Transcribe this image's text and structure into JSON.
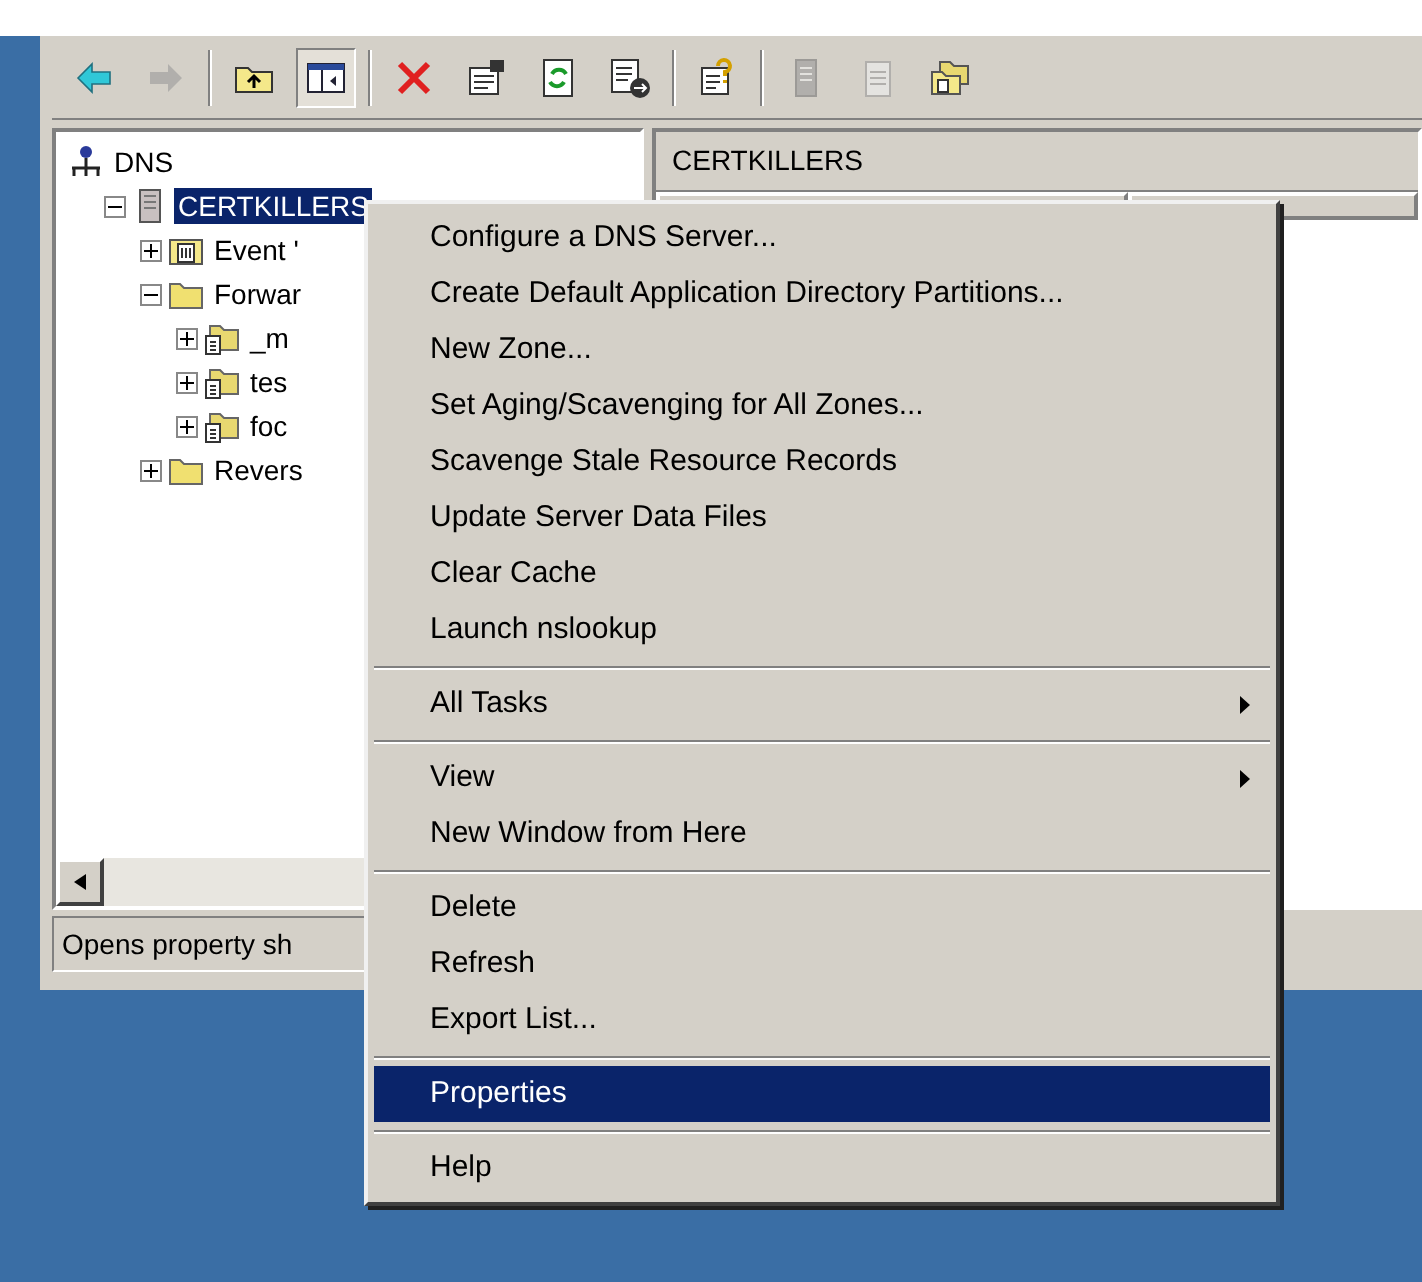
{
  "toolbar": [
    {
      "kind": "back",
      "disabled": false,
      "pressed": false
    },
    {
      "kind": "forward",
      "disabled": true,
      "pressed": false
    },
    {
      "kind": "sep"
    },
    {
      "kind": "up",
      "disabled": false,
      "pressed": false
    },
    {
      "kind": "tree",
      "disabled": false,
      "pressed": true
    },
    {
      "kind": "sep"
    },
    {
      "kind": "delete",
      "disabled": false,
      "pressed": false
    },
    {
      "kind": "properties",
      "disabled": false,
      "pressed": false
    },
    {
      "kind": "refresh",
      "disabled": false,
      "pressed": false
    },
    {
      "kind": "export",
      "disabled": false,
      "pressed": false
    },
    {
      "kind": "sep"
    },
    {
      "kind": "help",
      "disabled": false,
      "pressed": false
    },
    {
      "kind": "sep"
    },
    {
      "kind": "server",
      "disabled": true,
      "pressed": false
    },
    {
      "kind": "notepad",
      "disabled": true,
      "pressed": false
    },
    {
      "kind": "folders",
      "disabled": false,
      "pressed": false
    }
  ],
  "tree": [
    {
      "label": "DNS",
      "kind": "dns",
      "selected": false,
      "children": [
        {
          "label": "CERTKILLERS",
          "kind": "server",
          "selected": true,
          "expanded": true,
          "children": [
            {
              "label": "Event '",
              "kind": "log",
              "selected": false,
              "expanded": false
            },
            {
              "label": "Forwar",
              "kind": "folder",
              "selected": false,
              "expanded": true,
              "children": [
                {
                  "label": "_m",
                  "kind": "zone",
                  "selected": false,
                  "expanded": false
                },
                {
                  "label": "tes",
                  "kind": "zone",
                  "selected": false,
                  "expanded": false
                },
                {
                  "label": "foc",
                  "kind": "zone",
                  "selected": false,
                  "expanded": false
                }
              ]
            },
            {
              "label": "Revers",
              "kind": "folder",
              "selected": false,
              "expanded": false
            }
          ]
        }
      ]
    }
  ],
  "details": {
    "title": "CERTKILLERS"
  },
  "status_bar": "Opens property sh",
  "context_menu": [
    [
      {
        "label": "Configure a DNS Server...",
        "submenu": false,
        "selected": false
      },
      {
        "label": "Create Default Application Directory Partitions...",
        "submenu": false,
        "selected": false
      },
      {
        "label": "New Zone...",
        "submenu": false,
        "selected": false
      },
      {
        "label": "Set Aging/Scavenging for All Zones...",
        "submenu": false,
        "selected": false
      },
      {
        "label": "Scavenge Stale Resource Records",
        "submenu": false,
        "selected": false
      },
      {
        "label": "Update Server Data Files",
        "submenu": false,
        "selected": false
      },
      {
        "label": "Clear Cache",
        "submenu": false,
        "selected": false
      },
      {
        "label": "Launch nslookup",
        "submenu": false,
        "selected": false
      }
    ],
    [
      {
        "label": "All Tasks",
        "submenu": true,
        "selected": false
      }
    ],
    [
      {
        "label": "View",
        "submenu": true,
        "selected": false
      },
      {
        "label": "New Window from Here",
        "submenu": false,
        "selected": false
      }
    ],
    [
      {
        "label": "Delete",
        "submenu": false,
        "selected": false
      },
      {
        "label": "Refresh",
        "submenu": false,
        "selected": false
      },
      {
        "label": "Export List...",
        "submenu": false,
        "selected": false
      }
    ],
    [
      {
        "label": "Properties",
        "submenu": false,
        "selected": true
      }
    ],
    [
      {
        "label": "Help",
        "submenu": false,
        "selected": false
      }
    ]
  ]
}
